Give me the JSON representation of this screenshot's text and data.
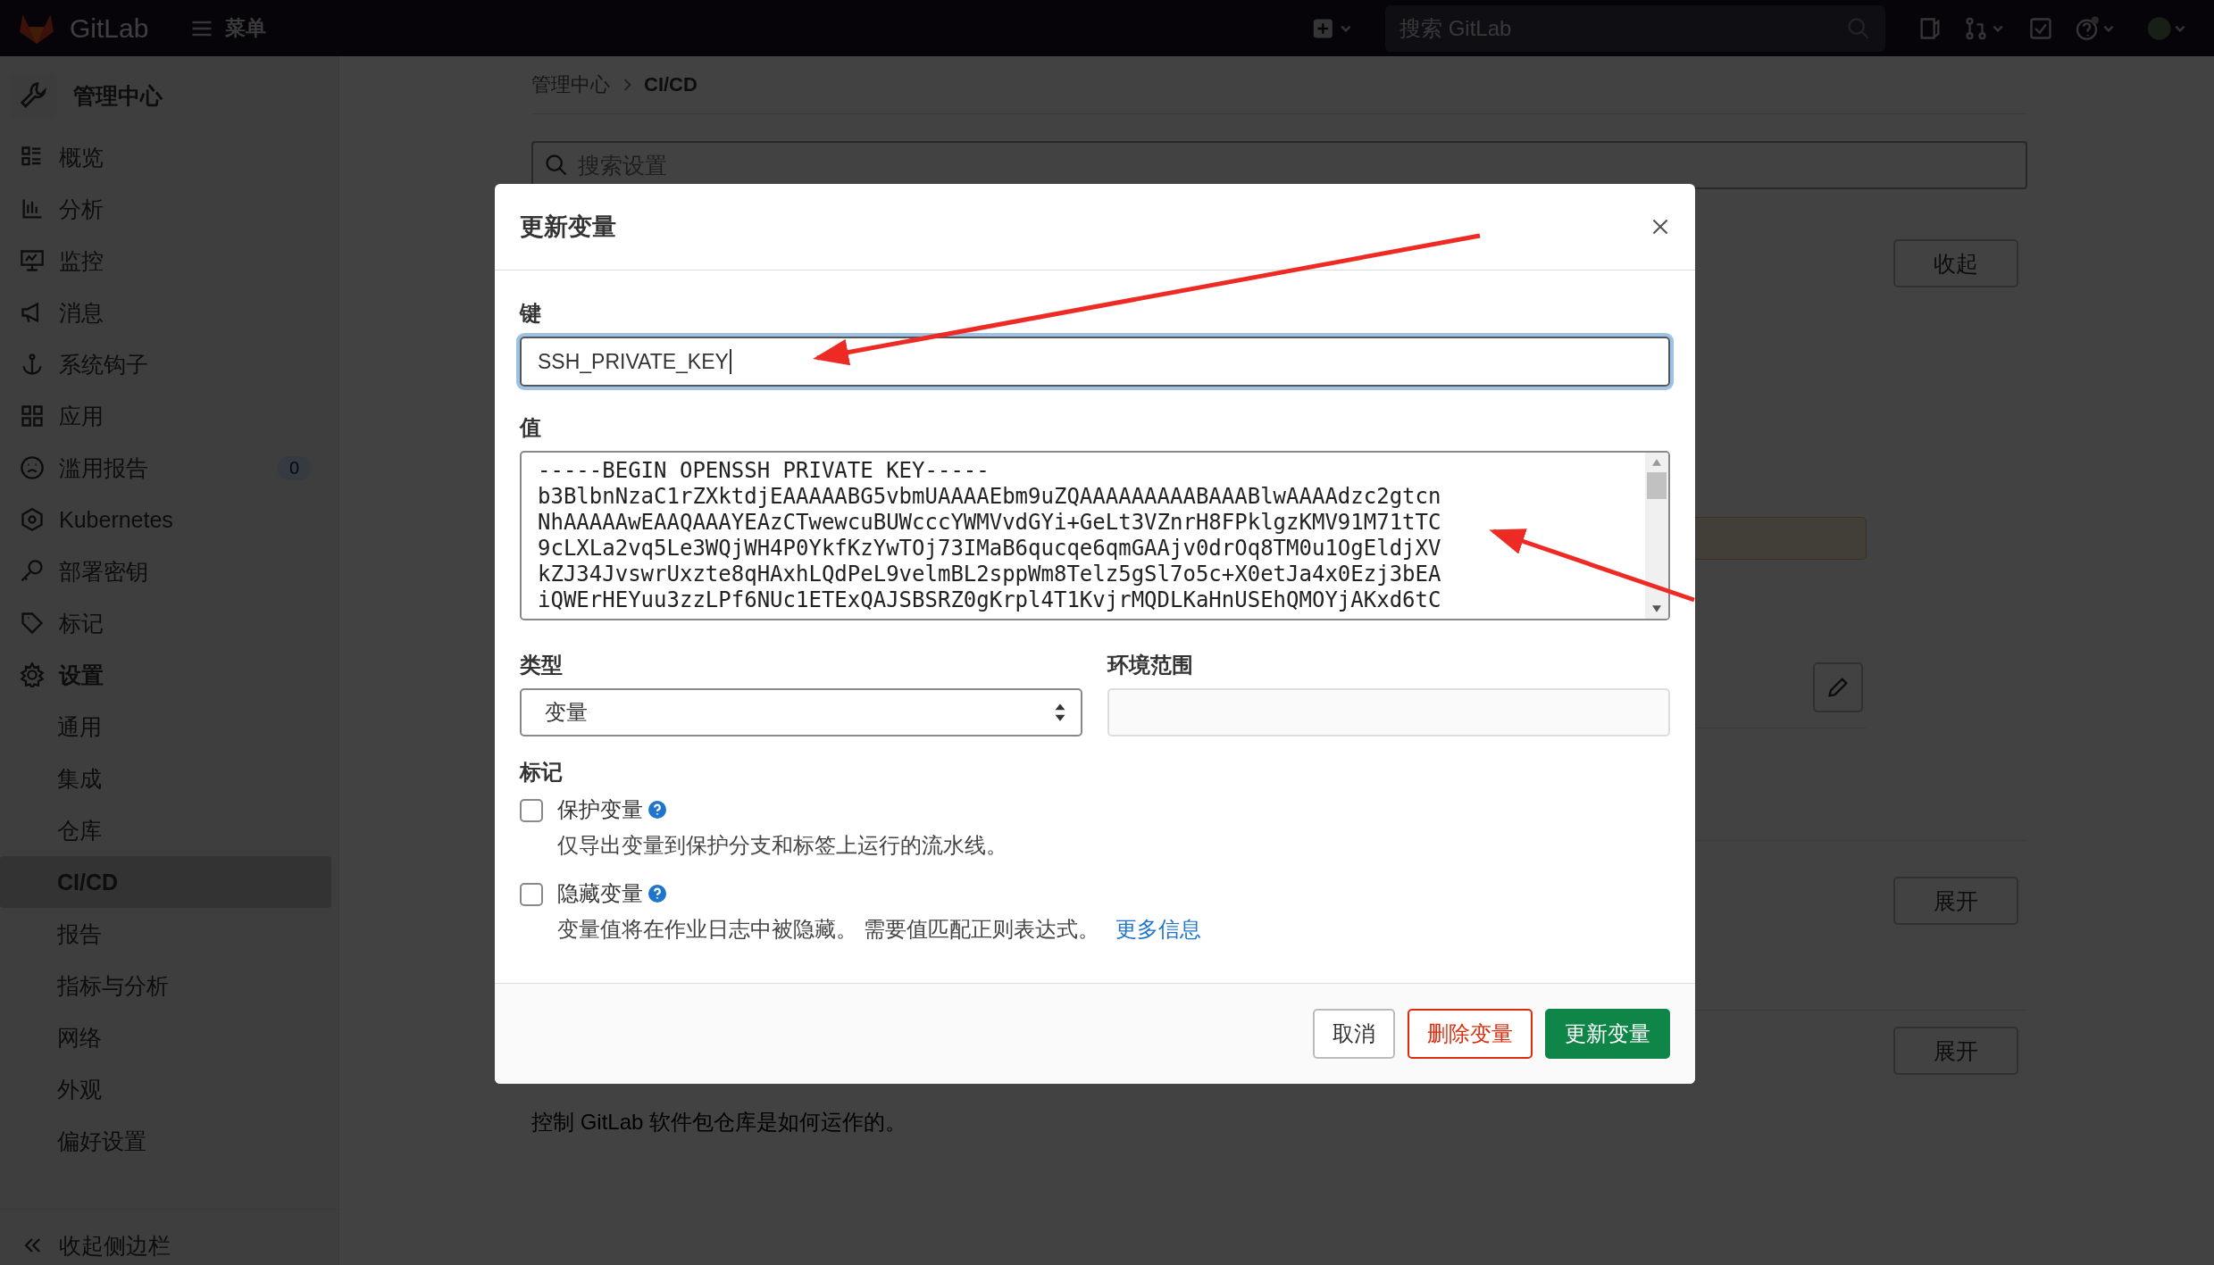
{
  "top_bar": {
    "logo_text": "GitLab",
    "menu_label": "菜单",
    "search": {
      "placeholder": "搜索 GitLab"
    }
  },
  "sidebar": {
    "title": "管理中心",
    "items": [
      {
        "label": "概览",
        "selected": false
      },
      {
        "label": "分析",
        "selected": false
      },
      {
        "label": "监控",
        "selected": false
      },
      {
        "label": "消息",
        "selected": false
      },
      {
        "label": "系统钩子",
        "selected": false
      },
      {
        "label": "应用",
        "selected": false
      },
      {
        "label": "滥用报告",
        "selected": false,
        "badge": "0"
      },
      {
        "label": "Kubernetes",
        "selected": false
      },
      {
        "label": "部署密钥",
        "selected": false
      },
      {
        "label": "标记",
        "selected": false
      },
      {
        "label": "设置",
        "selected": false,
        "expanded": true,
        "children": [
          {
            "label": "通用",
            "selected": false
          },
          {
            "label": "集成",
            "selected": false
          },
          {
            "label": "仓库",
            "selected": false
          },
          {
            "label": "CI/CD",
            "selected": true
          },
          {
            "label": "报告",
            "selected": false
          },
          {
            "label": "指标与分析",
            "selected": false
          },
          {
            "label": "网络",
            "selected": false
          },
          {
            "label": "外观",
            "selected": false
          },
          {
            "label": "偏好设置",
            "selected": false
          }
        ]
      }
    ],
    "collapse_label": "收起侧边栏"
  },
  "page": {
    "breadcrumb": [
      "管理中心",
      "CI/CD"
    ],
    "search": {
      "placeholder": "搜索设置"
    },
    "section_buttons": [
      "收起",
      "展开",
      "展开"
    ],
    "footer_text": "控制 GitLab 软件包仓库是如何运作的。"
  },
  "modal": {
    "title": "更新变量",
    "key": {
      "label": "键",
      "value": "SSH_PRIVATE_KEY"
    },
    "value": {
      "label": "值",
      "lines": [
        "-----BEGIN OPENSSH PRIVATE KEY-----",
        "b3BlbnNzaC1rZXktdjEAAAAABG5vbmUAAAAEbm9uZQAAAAAAAAABAAABlwAAAAdzc2gtcn",
        "NhAAAAAwEAAQAAAYEAzCTwewcuBUWcccYWMVvdGYi+GeLt3VZnrH8FPklgzKMV91M71tTC",
        "9cLXLa2vq5Le3WQjWH4P0YkfKzYwTOj73IMaB6qucqe6qmGAAjv0drOq8TM0u1OgEldjXV",
        "kZJ34JvswrUxzte8qHAxhLQdPeL9velmBL2sppWm8Telz5gSl7o5c+X0etJa4x0Ezj3bEA",
        "iQWErHEYuu3zzLPf6NUc1ETExQAJSBSRZ0gKrpl4T1KvjrMQDLKaHnUSEhQMOYjAKxd6tC"
      ]
    },
    "type": {
      "label": "类型",
      "value": "变量"
    },
    "environment": {
      "label": "环境范围"
    },
    "flags_label": "标记",
    "flags": [
      {
        "label": "保护变量",
        "checked": false,
        "description": "仅导出变量到保护分支和标签上运行的流水线。"
      },
      {
        "label": "隐藏变量",
        "checked": false,
        "description": "变量值将在作业日志中被隐藏。 需要值匹配正则表达式。",
        "link": "更多信息"
      }
    ],
    "buttons": [
      {
        "label": "取消",
        "kind": "secondary"
      },
      {
        "label": "删除变量",
        "kind": "danger"
      },
      {
        "label": "更新变量",
        "kind": "primary"
      }
    ]
  }
}
